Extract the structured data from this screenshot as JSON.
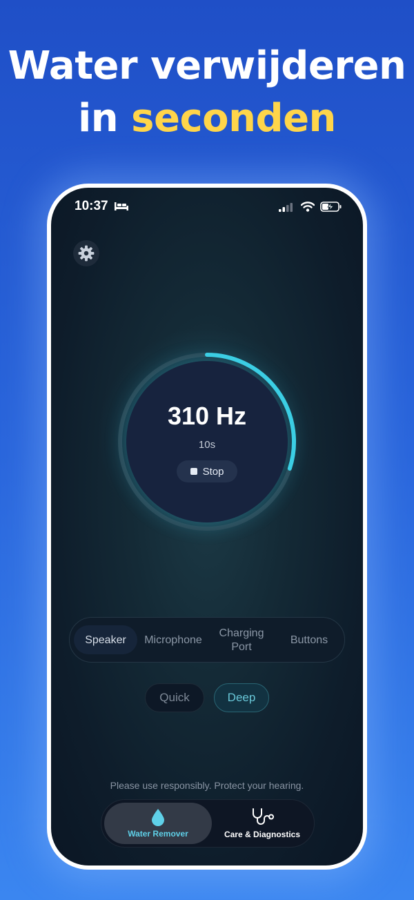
{
  "headline": {
    "line1": "Water verwijderen",
    "line2_prefix": "in ",
    "line2_accent": "seconden",
    "accent_color": "#ffd54a"
  },
  "status_bar": {
    "time": "10:37",
    "icons": [
      "bed-icon",
      "signal-icon",
      "wifi-icon",
      "battery-charging-icon"
    ]
  },
  "settings": {
    "icon": "gear-icon"
  },
  "dial": {
    "frequency": "310 Hz",
    "duration": "10s",
    "stop_label": "Stop",
    "progress": 0.3,
    "accent_color": "#3ccfe4"
  },
  "targets": {
    "items": [
      {
        "label": "Speaker",
        "active": true
      },
      {
        "label": "Microphone",
        "active": false
      },
      {
        "label": "Charging Port",
        "active": false
      },
      {
        "label": "Buttons",
        "active": false
      }
    ]
  },
  "modes": {
    "quick": "Quick",
    "deep": "Deep",
    "selected": "Deep"
  },
  "note": "Please use responsibly. Protect your hearing.",
  "tabbar": {
    "items": [
      {
        "label": "Water Remover",
        "icon": "water-drop-icon",
        "active": true
      },
      {
        "label": "Care & Diagnostics",
        "icon": "stethoscope-icon",
        "active": false
      }
    ]
  }
}
